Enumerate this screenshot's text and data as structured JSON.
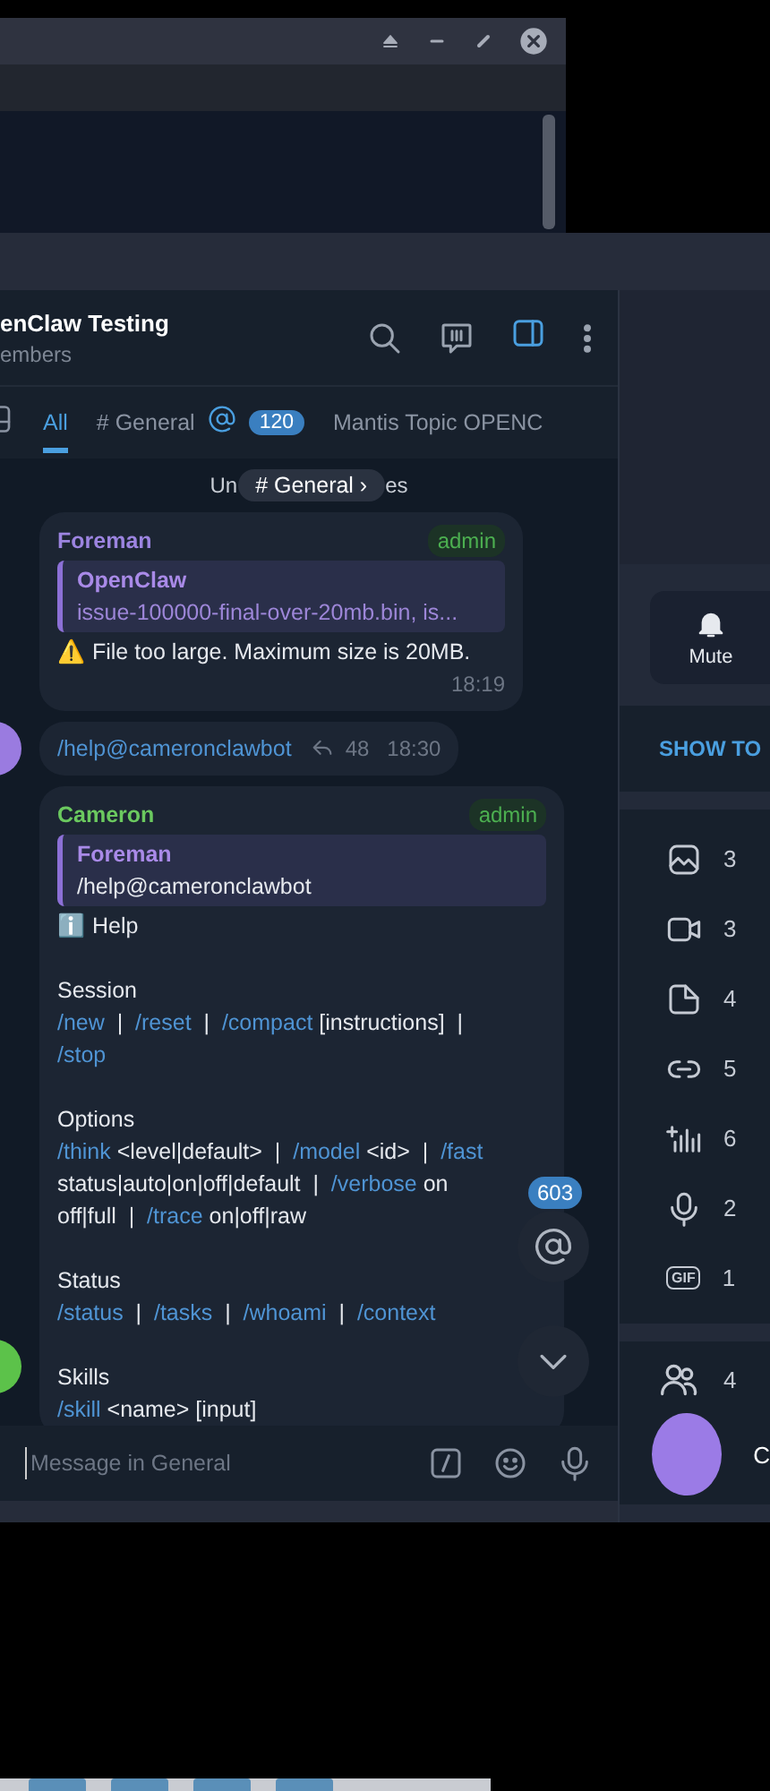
{
  "chat": {
    "title": "enClaw Testing",
    "subtitle": "embers",
    "tabs": [
      {
        "label": "All",
        "selected": true
      },
      {
        "label": "# General",
        "selected": false,
        "mention": true,
        "badge": "120"
      },
      {
        "label": "Mantis Topic OPENC",
        "selected": false
      }
    ],
    "divider": [
      "Un",
      "es"
    ],
    "topic_pill": "# General ›",
    "messages": [
      {
        "kind": "quoted",
        "sender": "Foreman",
        "color": "#9c84e0",
        "role": "admin",
        "reply": {
          "author": "OpenClaw",
          "text": "issue-100000-final-over-20mb.bin, is..."
        },
        "paragraphs": [
          [
            [
              {
                "kind": "text",
                "text": "⚠️ File too large. Maximum size is 20MB."
              }
            ]
          ]
        ],
        "time": "18:19"
      },
      {
        "kind": "command",
        "text": "/help@cameronclawbot",
        "replies": "48",
        "time": "18:30",
        "avatar": {
          "color": "#9a7be0"
        }
      },
      {
        "kind": "quoted",
        "sender": "Cameron",
        "color": "#6bc95f",
        "role": "admin",
        "avatar": {
          "color": "#5cc24a"
        },
        "reply": {
          "author": "Foreman",
          "text": "/help@cameronclawbot"
        },
        "paragraphs": [
          [
            [
              {
                "kind": "text",
                "text": "ℹ️ Help"
              }
            ]
          ],
          [
            [
              {
                "kind": "text",
                "text": "Session"
              }
            ],
            [
              {
                "kind": "command",
                "text": "/new"
              },
              {
                "kind": "text",
                "text": "  |  "
              },
              {
                "kind": "command",
                "text": "/reset"
              },
              {
                "kind": "text",
                "text": "  |  "
              },
              {
                "kind": "command",
                "text": "/compact"
              },
              {
                "kind": "text",
                "text": " [instructions]  |"
              }
            ],
            [
              {
                "kind": "command",
                "text": "/stop"
              }
            ]
          ],
          [
            [
              {
                "kind": "text",
                "text": "Options"
              }
            ],
            [
              {
                "kind": "command",
                "text": "/think"
              },
              {
                "kind": "text",
                "text": " <level|default>  |  "
              },
              {
                "kind": "command",
                "text": "/model"
              },
              {
                "kind": "text",
                "text": " <id>  |  "
              },
              {
                "kind": "command",
                "text": "/fast"
              }
            ],
            [
              {
                "kind": "text",
                "text": "status|auto|on|off|default  |  "
              },
              {
                "kind": "command",
                "text": "/verbose"
              },
              {
                "kind": "text",
                "text": " on"
              }
            ],
            [
              {
                "kind": "text",
                "text": "off|full  |  "
              },
              {
                "kind": "command",
                "text": "/trace"
              },
              {
                "kind": "text",
                "text": " on|off|raw"
              }
            ]
          ],
          [
            [
              {
                "kind": "text",
                "text": "Status"
              }
            ],
            [
              {
                "kind": "command",
                "text": "/status"
              },
              {
                "kind": "text",
                "text": "  |  "
              },
              {
                "kind": "command",
                "text": "/tasks"
              },
              {
                "kind": "text",
                "text": "  |  "
              },
              {
                "kind": "command",
                "text": "/whoami"
              },
              {
                "kind": "text",
                "text": "  |  "
              },
              {
                "kind": "command",
                "text": "/context"
              }
            ]
          ],
          [
            [
              {
                "kind": "text",
                "text": "Skills"
              }
            ],
            [
              {
                "kind": "command",
                "text": "/skill"
              },
              {
                "kind": "text",
                "text": " <name> [input]"
              }
            ]
          ]
        ]
      }
    ],
    "mention_badge": "603",
    "input": {
      "placeholder": "Message in General"
    }
  },
  "side_panel": {
    "mute": "Mute",
    "show_topics": "SHOW TO",
    "media": [
      {
        "kind": "photo",
        "count": "3"
      },
      {
        "kind": "video",
        "count": "3"
      },
      {
        "kind": "file",
        "count": "4"
      },
      {
        "kind": "link",
        "count": "5"
      },
      {
        "kind": "audio",
        "count": "6"
      },
      {
        "kind": "voice",
        "count": "2"
      },
      {
        "kind": "gif",
        "count": "1",
        "icon_text": "GIF"
      }
    ],
    "members": "4",
    "member_initial": "C"
  }
}
